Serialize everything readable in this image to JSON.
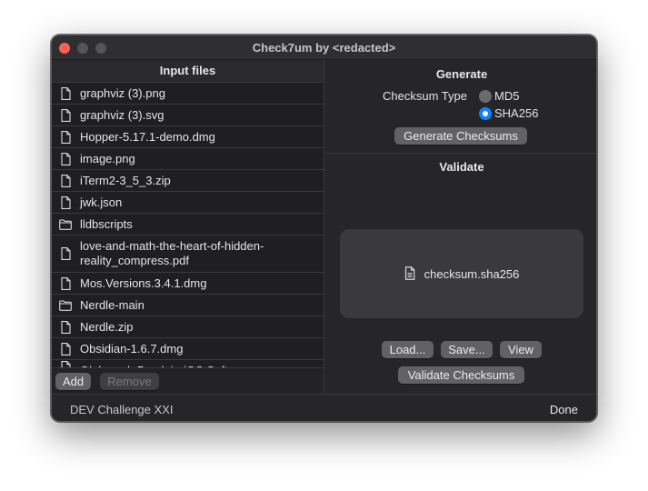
{
  "window": {
    "title": "Check7um by <redacted>"
  },
  "input_files": {
    "header": "Input files",
    "items": [
      {
        "name": "graphviz (3).png",
        "type": "file"
      },
      {
        "name": "graphviz (3).svg",
        "type": "file"
      },
      {
        "name": "Hopper-5.17.1-demo.dmg",
        "type": "file"
      },
      {
        "name": "image.png",
        "type": "file"
      },
      {
        "name": "iTerm2-3_5_3.zip",
        "type": "file"
      },
      {
        "name": "jwk.json",
        "type": "file"
      },
      {
        "name": "lldbscripts",
        "type": "folder"
      },
      {
        "name": "love-and-math-the-heart-of-hidden-reality_compress.pdf",
        "type": "file"
      },
      {
        "name": "Mos.Versions.3.4.1.dmg",
        "type": "file"
      },
      {
        "name": "Nerdle-main",
        "type": "folder"
      },
      {
        "name": "Nerdle.zip",
        "type": "file"
      },
      {
        "name": "Obsidian-1.6.7.dmg",
        "type": "file"
      },
      {
        "name": "Oleksandr Barslai - iOS Software",
        "type": "file"
      }
    ],
    "add_label": "Add",
    "remove_label": "Remove"
  },
  "generate": {
    "title": "Generate",
    "checksum_type_label": "Checksum Type",
    "options": [
      {
        "label": "MD5",
        "selected": false
      },
      {
        "label": "SHA256",
        "selected": true
      }
    ],
    "button_label": "Generate Checksums"
  },
  "validate": {
    "title": "Validate",
    "file_name": "checksum.sha256",
    "load_label": "Load...",
    "save_label": "Save...",
    "view_label": "View",
    "button_label": "Validate Checksums"
  },
  "footer": {
    "left_text": "DEV Challenge XXI",
    "done_label": "Done"
  },
  "colors": {
    "accent": "#0a84ff",
    "close": "#ff5f57"
  }
}
